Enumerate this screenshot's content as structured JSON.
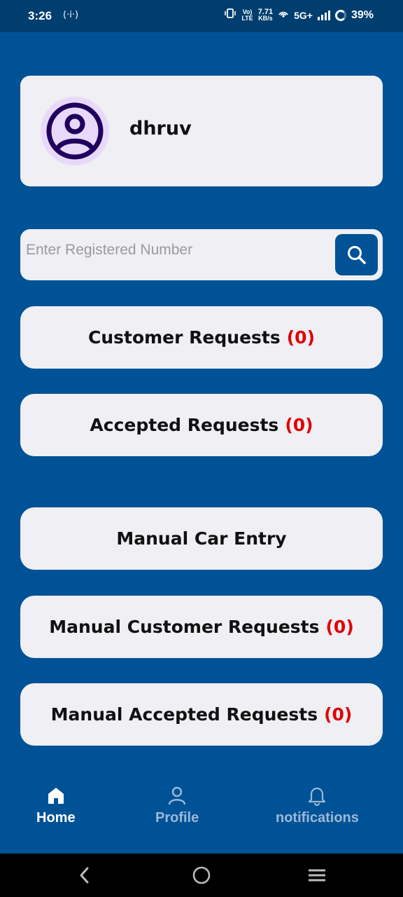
{
  "status_bar": {
    "time": "3:26",
    "hotspot": "(·i·)",
    "volte_top": "Vo)",
    "volte_bottom": "LTE",
    "speed_top": "7.71",
    "speed_bottom": "KB/s",
    "network": "5G+",
    "battery": "39%"
  },
  "profile": {
    "username": "dhruv",
    "avatar_icon": "account-circle-icon"
  },
  "search": {
    "placeholder": "Enter Registered Number",
    "value": "",
    "button_icon": "search-icon"
  },
  "actions": [
    {
      "label": "Customer Requests",
      "count": "(0)"
    },
    {
      "label": "Accepted Requests",
      "count": "(0)"
    },
    {
      "label": "Manual Car Entry",
      "count": ""
    },
    {
      "label": "Manual Customer Requests",
      "count": "(0)"
    },
    {
      "label": "Manual Accepted Requests",
      "count": "(0)"
    }
  ],
  "bottom_nav": {
    "items": [
      {
        "label": "Home",
        "icon": "home-icon",
        "active": true
      },
      {
        "label": "Profile",
        "icon": "person-icon",
        "active": false
      },
      {
        "label": "notifications",
        "icon": "bell-icon",
        "active": false
      }
    ]
  },
  "colors": {
    "background": "#005296",
    "card": "#efeff4",
    "count": "#e00000",
    "avatar_bg": "#e8d9fb",
    "avatar_fg": "#21005d"
  }
}
